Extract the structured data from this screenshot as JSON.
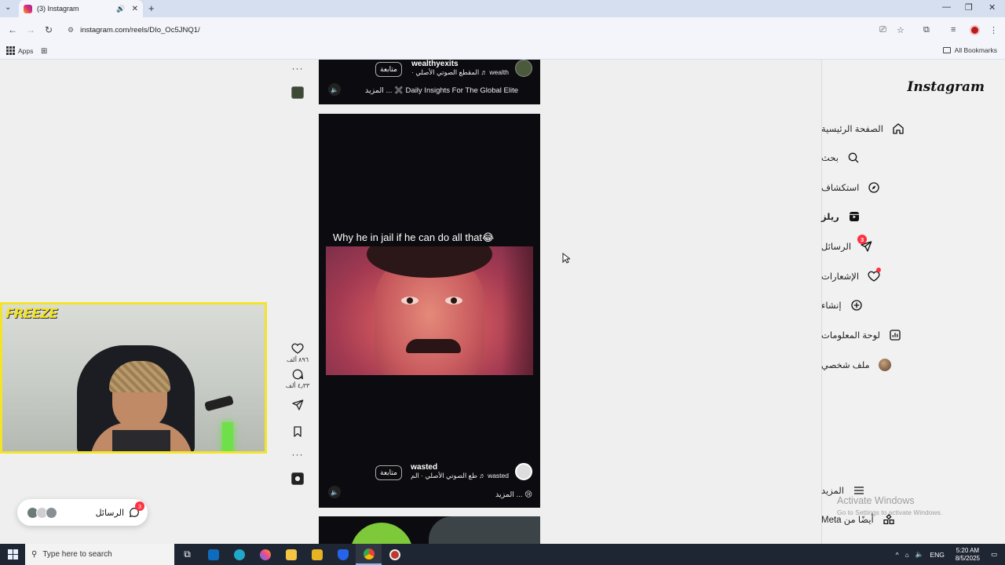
{
  "browser": {
    "tab_title": "(3) Instagram",
    "url": "instagram.com/reels/DIo_Oc5JNQ1/",
    "bookmarks": {
      "apps_label": "Apps",
      "all_bookmarks_label": "All Bookmarks"
    }
  },
  "sidebar": {
    "logo": "Instagram",
    "items": [
      {
        "label": "الصفحة الرئيسية",
        "icon": "home-icon"
      },
      {
        "label": "بحث",
        "icon": "search-icon"
      },
      {
        "label": "استكشاف",
        "icon": "compass-icon"
      },
      {
        "label": "ريلز",
        "icon": "reels-icon",
        "active": true
      },
      {
        "label": "الرسائل",
        "icon": "send-icon",
        "badge": "3"
      },
      {
        "label": "الإشعارات",
        "icon": "heart-icon",
        "dot": true
      },
      {
        "label": "إنشاء",
        "icon": "plus-square-icon"
      },
      {
        "label": "لوحة المعلومات",
        "icon": "chart-icon"
      },
      {
        "label": "ملف شخصي",
        "icon": "avatar"
      }
    ],
    "bottom": [
      {
        "label": "المزيد",
        "icon": "menu-icon"
      },
      {
        "label": "أيضًا من Meta",
        "icon": "grid-icon"
      }
    ]
  },
  "reel_top": {
    "username": "wealthyexits",
    "audio": "wealth ♬ المقطع الصوتي الأصلي ·",
    "follow_label": "متابعة",
    "caption": "Daily Insights For The Global Elite ✖️ ... المزيد"
  },
  "reel_main": {
    "overlay_text": "Why he in jail if he can do all that😂",
    "username": "wasted",
    "audio": "wasted ♬ طع الصوتي الأصلي · الم",
    "follow_label": "متابعة",
    "caption": "😢 ... المزيد",
    "likes": "٨٩٦ ألف",
    "comments": "٤٫٣٣ ألف"
  },
  "overlay": {
    "streamer_tag": "FREEZE",
    "messages_label": "الرسائل",
    "messages_badge": "3"
  },
  "watermark": {
    "line1": "Activate Windows",
    "line2": "Go to Settings to activate Windows."
  },
  "taskbar": {
    "search_placeholder": "Type here to search",
    "lang": "ENG",
    "time": "5:20 AM",
    "date": "8/5/2025"
  },
  "colors": {
    "badge": "#ff3040",
    "webcam_border": "#f2e42a",
    "taskbar": "#1f2633"
  }
}
